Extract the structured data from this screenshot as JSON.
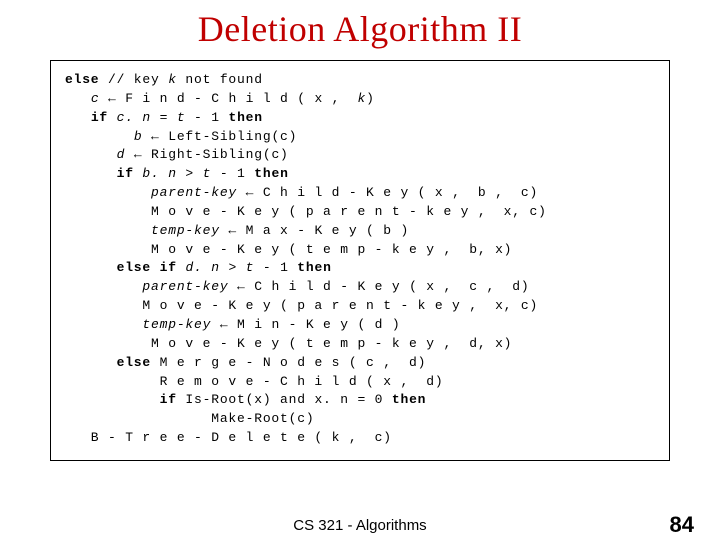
{
  "title": "Deletion Algorithm II",
  "code": {
    "l1a": "else",
    "l1b": " // key ",
    "l1c": "k",
    "l1d": " not found",
    "l2a": "   ",
    "l2b": "c",
    "l2c": " ← F i n d - C h i l d ( x ,  ",
    "l2d": "k",
    "l2e": ")",
    "l3a": "   ",
    "l3b": "if",
    "l3c": " ",
    "l3d": "c. n",
    "l3e": " = ",
    "l3f": "t",
    "l3g": " - 1 ",
    "l3h": "then",
    "l4a": "        ",
    "l4b": "b",
    "l4c": " ← Left-Sibling(c)",
    "l5a": "      ",
    "l5b": "d",
    "l5c": " ← Right-Sibling(c)",
    "l6a": "      ",
    "l6b": "if",
    "l6c": " ",
    "l6d": "b. n",
    "l6e": " > ",
    "l6f": "t",
    "l6g": " - 1 ",
    "l6h": "then",
    "l7a": "          ",
    "l7b": "parent-key",
    "l7c": " ← C h i l d - K e y ( x ,  b ,  c)",
    "l8": "          M o v e - K e y ( p a r e n t - k e y ,  x, c)",
    "l9a": "          ",
    "l9b": "temp-key",
    "l9c": " ← M a x - K e y ( b )",
    "l10": "          M o v e - K e y ( t e m p - k e y ,  b, x)",
    "l11a": "      ",
    "l11b": "else if",
    "l11c": " ",
    "l11d": "d. n",
    "l11e": " > ",
    "l11f": "t",
    "l11g": " - 1 ",
    "l11h": "then",
    "l12a": "         ",
    "l12b": "parent-key",
    "l12c": " ← C h i l d - K e y ( x ,  c ,  d)",
    "l13": "         M o v e - K e y ( p a r e n t - k e y ,  x, c)",
    "l14a": "         ",
    "l14b": "temp-key",
    "l14c": " ← M i n - K e y ( d )",
    "l15": "          M o v e - K e y ( t e m p - k e y ,  d, x)",
    "l16a": "      ",
    "l16b": "else",
    "l16c": " M e r g e - N o d e s ( c ,  d)",
    "l17": "           R e m o v e - C h i l d ( x ,  d)",
    "l18a": "           ",
    "l18b": "if",
    "l18c": " Is-Root(x) and x. n = 0 ",
    "l18d": "then",
    "l19": "                 Make-Root(c)",
    "l20": "   B - T r e e - D e l e t e ( k ,  c)"
  },
  "footer": "CS 321 - Algorithms",
  "page": "84"
}
